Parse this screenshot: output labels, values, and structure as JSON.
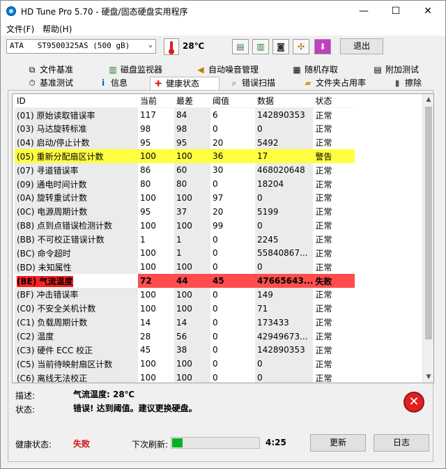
{
  "window": {
    "title": "HD Tune Pro 5.70 - 硬盘/固态硬盘实用程序",
    "minimize_glyph": "—",
    "maximize_glyph": "☐",
    "close_glyph": "✕"
  },
  "menu": {
    "file": "文件(F)",
    "help": "帮助(H)"
  },
  "toolbar": {
    "drive": "ATA   ST9500325AS (500 gB)",
    "drive_arrow": "⌄",
    "temperature": "28℃",
    "exit_label": "退出",
    "icons": [
      "copy-icon",
      "copy-info-icon",
      "camera-icon",
      "options-icon",
      "save-icon"
    ]
  },
  "tabs_top": [
    {
      "label": "文件基准",
      "icon": "file-benchmark-icon",
      "glyph": "⧉"
    },
    {
      "label": "磁盘监视器",
      "icon": "disk-monitor-icon",
      "glyph": "▥"
    },
    {
      "label": "自动噪音管理",
      "icon": "speaker-icon",
      "glyph": "◀"
    },
    {
      "label": "随机存取",
      "icon": "random-access-icon",
      "glyph": "▦"
    },
    {
      "label": "附加测试",
      "icon": "extra-tests-icon",
      "glyph": "▤"
    }
  ],
  "tabs_bottom": [
    {
      "label": "基准测试",
      "icon": "benchmark-icon",
      "glyph": "⏱"
    },
    {
      "label": "信息",
      "icon": "info-icon",
      "glyph": "i"
    },
    {
      "label": "健康状态",
      "icon": "health-cross-icon",
      "glyph": "✚"
    },
    {
      "label": "错误扫描",
      "icon": "magnifier-icon",
      "glyph": "⌕"
    },
    {
      "label": "文件夹占用率",
      "icon": "folder-icon",
      "glyph": "▰"
    },
    {
      "label": "擦除",
      "icon": "trash-icon",
      "glyph": "▮"
    }
  ],
  "table": {
    "headers": [
      "ID",
      "当前",
      "最差",
      "阈值",
      "数据",
      "状态"
    ],
    "rows": [
      {
        "id": "(01) 原始读取错误率",
        "cur": "117",
        "worst": "84",
        "thr": "6",
        "data": "142890353",
        "status": "正常"
      },
      {
        "id": "(03) 马达旋转标准",
        "cur": "98",
        "worst": "98",
        "thr": "0",
        "data": "0",
        "status": "正常"
      },
      {
        "id": "(04) 启动/停止计数",
        "cur": "95",
        "worst": "95",
        "thr": "20",
        "data": "5492",
        "status": "正常"
      },
      {
        "id": "(05) 重新分配扇区计数",
        "cur": "100",
        "worst": "100",
        "thr": "36",
        "data": "17",
        "status": "警告",
        "state": "warn"
      },
      {
        "id": "(07) 寻道错误率",
        "cur": "86",
        "worst": "60",
        "thr": "30",
        "data": "468020648",
        "status": "正常"
      },
      {
        "id": "(09) 通电时间计数",
        "cur": "80",
        "worst": "80",
        "thr": "0",
        "data": "18204",
        "status": "正常"
      },
      {
        "id": "(0A) 旋转重试计数",
        "cur": "100",
        "worst": "100",
        "thr": "97",
        "data": "0",
        "status": "正常"
      },
      {
        "id": "(0C) 电源周期计数",
        "cur": "95",
        "worst": "37",
        "thr": "20",
        "data": "5199",
        "status": "正常"
      },
      {
        "id": "(B8) 点到点错误检测计数",
        "cur": "100",
        "worst": "100",
        "thr": "99",
        "data": "0",
        "status": "正常"
      },
      {
        "id": "(BB) 不可校正错误计数",
        "cur": "1",
        "worst": "1",
        "thr": "0",
        "data": "2245",
        "status": "正常"
      },
      {
        "id": "(BC) 命令超时",
        "cur": "100",
        "worst": "1",
        "thr": "0",
        "data": "55840867...",
        "status": "正常"
      },
      {
        "id": "(BD) 未知属性",
        "cur": "100",
        "worst": "100",
        "thr": "0",
        "data": "0",
        "status": "正常"
      },
      {
        "id": "(BE) 气流温度",
        "cur": "72",
        "worst": "44",
        "thr": "45",
        "data": "47665643...",
        "status": "失败",
        "state": "fail"
      },
      {
        "id": "(BF) 冲击错误率",
        "cur": "100",
        "worst": "100",
        "thr": "0",
        "data": "149",
        "status": "正常"
      },
      {
        "id": "(C0) 不安全关机计数",
        "cur": "100",
        "worst": "100",
        "thr": "0",
        "data": "71",
        "status": "正常"
      },
      {
        "id": "(C1) 负载周期计数",
        "cur": "14",
        "worst": "14",
        "thr": "0",
        "data": "173433",
        "status": "正常"
      },
      {
        "id": "(C2) 温度",
        "cur": "28",
        "worst": "56",
        "thr": "0",
        "data": "42949673...",
        "status": "正常"
      },
      {
        "id": "(C3) 硬件 ECC 校正",
        "cur": "45",
        "worst": "38",
        "thr": "0",
        "data": "142890353",
        "status": "正常"
      },
      {
        "id": "(C5) 当前待映射扇区计数",
        "cur": "100",
        "worst": "100",
        "thr": "0",
        "data": "0",
        "status": "正常"
      },
      {
        "id": "(C6) 离线无法校正",
        "cur": "100",
        "worst": "100",
        "thr": "0",
        "data": "0",
        "status": "正常"
      }
    ]
  },
  "details": {
    "desc_label": "描述:",
    "desc_value": "气流温度: 28℃",
    "status_label": "状态:",
    "status_value": "错误! 达到阈值。建议更换硬盘。"
  },
  "footer": {
    "health_label": "健康状态:",
    "health_value": "失败",
    "refresh_label": "下次刷新:",
    "refresh_progress": 0.12,
    "countdown": "4:25",
    "refresh_button": "更新",
    "log_button": "日志",
    "progress_color": "#06b025"
  },
  "colors": {
    "warning_row": "#ffff40",
    "fail_row": "#ff4d4d",
    "fail_text": "#d01010"
  }
}
